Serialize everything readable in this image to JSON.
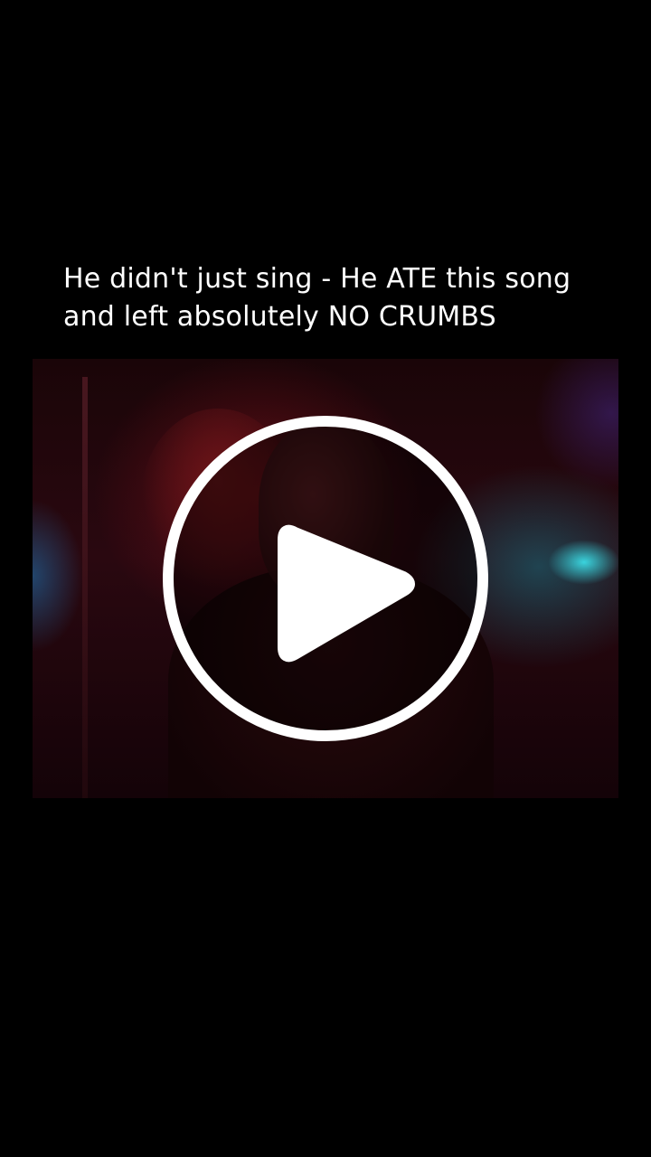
{
  "caption": {
    "lines": [
      "He didn't just sing - He ATE this song",
      "and left absolutely NO CRUMBS"
    ]
  },
  "video": {
    "state": "paused",
    "overlay_icon": "play-icon"
  },
  "colors": {
    "background": "#000000",
    "caption_text": "#ffffff",
    "play_button": "#ffffff"
  }
}
